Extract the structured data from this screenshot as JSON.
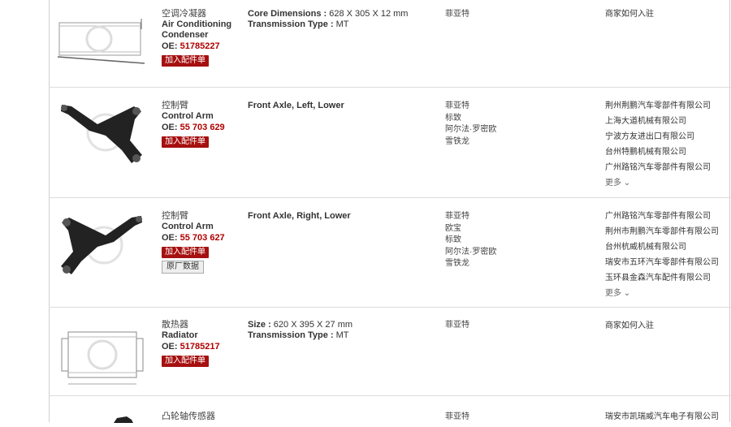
{
  "rows": [
    {
      "name_cn": "空调冷凝器",
      "name_en": "Air Conditioning Condenser",
      "oe_prefix": "OE:",
      "oe_number": "51785227",
      "add_label": "加入配件单",
      "specs": [
        {
          "key": "Core Dimensions :",
          "value": "628 X 305 X 12 mm"
        },
        {
          "key": "Transmission Type :",
          "value": "MT"
        }
      ],
      "vehicles": [
        "菲亚特"
      ],
      "suppliers": [
        "商家如何入驻"
      ]
    },
    {
      "name_cn": "控制臂",
      "name_en": "Control Arm",
      "oe_prefix": "OE:",
      "oe_number": "55 703 629",
      "add_label": "加入配件单",
      "specs": [
        {
          "key": "Front Axle, Left, Lower",
          "value": ""
        }
      ],
      "vehicles": [
        "菲亚特",
        "标致",
        "阿尔法·罗密欧",
        "雪铁龙"
      ],
      "suppliers": [
        "荆州荆鹏汽车零部件有限公司",
        "上海大道机械有限公司",
        "宁波方友进出口有限公司",
        "台州特鹏机械有限公司",
        "广州路铭汽车零部件有限公司"
      ],
      "more_label": "更多"
    },
    {
      "name_cn": "控制臂",
      "name_en": "Control Arm",
      "oe_prefix": "OE:",
      "oe_number": "55 703 627",
      "add_label": "加入配件单",
      "data_label": "原厂数据",
      "specs": [
        {
          "key": "Front Axle, Right, Lower",
          "value": ""
        }
      ],
      "vehicles": [
        "菲亚特",
        "欧宝",
        "标致",
        "阿尔法·罗密欧",
        "雪铁龙"
      ],
      "suppliers": [
        "广州路铭汽车零部件有限公司",
        "荆州市荆鹏汽车零部件有限公司",
        "台州杭威机械有限公司",
        "瑞安市五环汽车零部件有限公司",
        "玉环县金森汽车配件有限公司"
      ],
      "more_label": "更多"
    },
    {
      "name_cn": "散热器",
      "name_en": "Radiator",
      "oe_prefix": "OE:",
      "oe_number": "51785217",
      "add_label": "加入配件单",
      "specs": [
        {
          "key": "Size :",
          "value": "620 X 395 X 27 mm"
        },
        {
          "key": "Transmission Type :",
          "value": "MT"
        }
      ],
      "vehicles": [
        "菲亚特"
      ],
      "suppliers": [
        "商家如何入驻"
      ]
    },
    {
      "name_cn": "凸轮轴传感器",
      "vehicles": [
        "菲亚特"
      ],
      "suppliers": [
        "瑞安市凯瑞威汽车电子有限公司"
      ]
    }
  ]
}
